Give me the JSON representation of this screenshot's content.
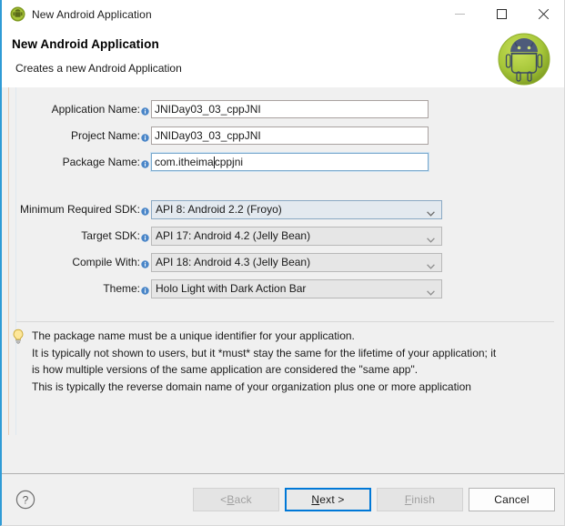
{
  "window": {
    "title": "New Android Application",
    "title_icon": "android-icon",
    "controls": {
      "minimize": "minimize-icon",
      "maximize": "maximize-icon",
      "close": "close-icon"
    }
  },
  "header": {
    "title": "New Android Application",
    "subtitle": "Creates a new Android Application",
    "logo": "android-robot-logo"
  },
  "form": {
    "fields": [
      {
        "label": "Application Name:",
        "info_icon": "info-icon",
        "value": "JNIDay03_03_cppJNI",
        "type": "text",
        "focused": false,
        "name": "application-name"
      },
      {
        "label": "Project Name:",
        "info_icon": "info-icon",
        "value": "JNIDay03_03_cppJNI",
        "type": "text",
        "focused": false,
        "name": "project-name"
      },
      {
        "label": "Package Name:",
        "info_icon": "info-icon",
        "value_before_caret": "com.itheima",
        "value_after_caret": "cppjni",
        "value": "com.itheimacppjni",
        "type": "text",
        "focused": true,
        "name": "package-name"
      }
    ],
    "combos": [
      {
        "label": "Minimum Required SDK:",
        "info_icon": "info-icon",
        "value": "API 8: Android 2.2 (Froyo)",
        "focused": true,
        "name": "minimum-required-sdk"
      },
      {
        "label": "Target SDK:",
        "info_icon": "info-icon",
        "value": "API 17: Android 4.2 (Jelly Bean)",
        "focused": false,
        "name": "target-sdk"
      },
      {
        "label": "Compile With:",
        "info_icon": "info-icon",
        "value": "API 18: Android 4.3 (Jelly Bean)",
        "focused": false,
        "name": "compile-with"
      },
      {
        "label": "Theme:",
        "info_icon": "info-icon",
        "value": "Holo Light with Dark Action Bar",
        "focused": false,
        "name": "theme"
      }
    ]
  },
  "hint": {
    "icon": "lightbulb-icon",
    "text": "The package name must be a unique identifier for your application.\nIt is typically not shown to users, but it *must* stay the same for the lifetime of your application; it\nis how multiple versions of the same application are considered the \"same app\".\nThis is typically the reverse domain name of your organization plus one or more application"
  },
  "footer": {
    "help_icon": "help-icon",
    "buttons": [
      {
        "label": "< Back",
        "mnemonic": "B",
        "state": "disabled",
        "name": "back-button"
      },
      {
        "label": "Next >",
        "mnemonic": "N",
        "state": "default",
        "name": "next-button"
      },
      {
        "label": "Finish",
        "mnemonic": "F",
        "state": "disabled",
        "name": "finish-button"
      },
      {
        "label": "Cancel",
        "mnemonic": "",
        "state": "normal",
        "name": "cancel-button"
      }
    ],
    "back_pre": "< ",
    "back_mn": "B",
    "back_post": "ack",
    "next_mn": "N",
    "next_post": "ext >",
    "finish_mn": "F",
    "finish_post": "inish",
    "cancel_label": "Cancel"
  },
  "colors": {
    "accent": "#0078d7",
    "window_border": "#2f9bd6",
    "content_bg": "#f0f0f0",
    "android_green": "#a4c639"
  }
}
